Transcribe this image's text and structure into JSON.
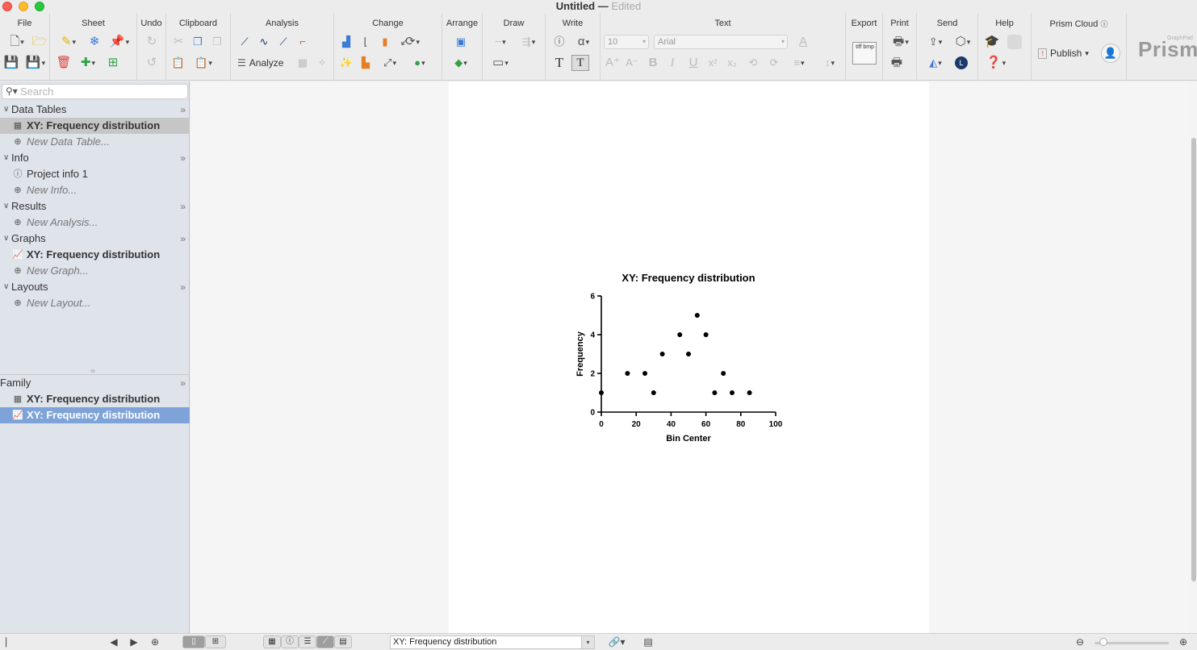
{
  "window": {
    "title": "Untitled",
    "separator": "—",
    "status": "Edited"
  },
  "toolbar": {
    "groups": {
      "file": "File",
      "sheet": "Sheet",
      "undo": "Undo",
      "clipboard": "Clipboard",
      "analysis": "Analysis",
      "change": "Change",
      "arrange": "Arrange",
      "draw": "Draw",
      "write": "Write",
      "text": "Text",
      "export": "Export",
      "print": "Print",
      "send": "Send",
      "help": "Help",
      "prism_cloud": "Prism Cloud"
    },
    "analyze_label": "Analyze",
    "font_size": "10",
    "font_name": "Arial",
    "publish_label": "Publish",
    "export_badge": "tiff bmp",
    "logo_text": "Prism",
    "logo_sub": "GraphPad",
    "alpha_glyph": "α"
  },
  "sidebar": {
    "search_placeholder": "Search",
    "sections": {
      "data_tables": "Data Tables",
      "info": "Info",
      "results": "Results",
      "graphs": "Graphs",
      "layouts": "Layouts"
    },
    "items": {
      "data_table": "XY: Frequency distribution",
      "new_data_table": "New Data Table...",
      "project_info": "Project info 1",
      "new_info": "New Info...",
      "new_analysis": "New Analysis...",
      "graph": "XY: Frequency distribution",
      "new_graph": "New Graph...",
      "new_layout": "New Layout..."
    },
    "family": {
      "header": "Family",
      "items": [
        "XY: Frequency distribution",
        "XY: Frequency distribution"
      ]
    }
  },
  "bottombar": {
    "sheet_selector": "XY: Frequency distribution"
  },
  "chart_data": {
    "type": "scatter",
    "title": "XY: Frequency distribution",
    "xlabel": "Bin Center",
    "ylabel": "Frequency",
    "xlim": [
      0,
      100
    ],
    "ylim": [
      0,
      6
    ],
    "xticks": [
      0,
      20,
      40,
      60,
      80,
      100
    ],
    "yticks": [
      0,
      2,
      4,
      6
    ],
    "grid": false,
    "marker": "filled-circle",
    "color": "#000000",
    "points": [
      {
        "x": 0,
        "y": 1
      },
      {
        "x": 15,
        "y": 2
      },
      {
        "x": 25,
        "y": 2
      },
      {
        "x": 30,
        "y": 1
      },
      {
        "x": 35,
        "y": 3
      },
      {
        "x": 45,
        "y": 4
      },
      {
        "x": 50,
        "y": 3
      },
      {
        "x": 55,
        "y": 5
      },
      {
        "x": 60,
        "y": 4
      },
      {
        "x": 65,
        "y": 1
      },
      {
        "x": 70,
        "y": 2
      },
      {
        "x": 75,
        "y": 1
      },
      {
        "x": 85,
        "y": 1
      }
    ]
  }
}
